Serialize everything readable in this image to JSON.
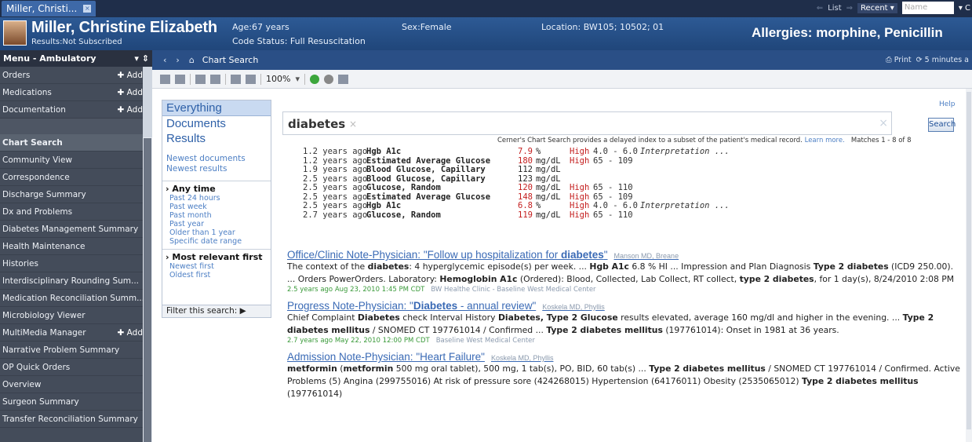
{
  "titlebar": {
    "tab_label": "Miller, Christi...",
    "tab_close": "×",
    "list_label": "List",
    "recent_label": "Recent",
    "recent_caret": "▾",
    "name_placeholder": "Name",
    "trailing": "▾ C"
  },
  "banner": {
    "name": "Miller, Christine Elizabeth",
    "results": "Results:Not Subscribed",
    "age": "Age:67 years",
    "code_status": "Code Status: Full Resuscitation",
    "sex": "Sex:Female",
    "location": "Location: BW105; 10502; 01",
    "allergies": "Allergies: morphine, Penicillin"
  },
  "menu": {
    "header": "Menu - Ambulatory",
    "header_icons": "▾ ⇕",
    "add_label": "Add",
    "items_top": [
      {
        "label": "Orders",
        "add": true
      },
      {
        "label": "Medications",
        "add": true
      },
      {
        "label": "Documentation",
        "add": true
      }
    ],
    "items": [
      {
        "label": "Chart Search",
        "active": true
      },
      {
        "label": "Community View"
      },
      {
        "label": "Correspondence"
      },
      {
        "label": "Discharge Summary"
      },
      {
        "label": "Dx and Problems"
      },
      {
        "label": "Diabetes Management Summary"
      },
      {
        "label": "Health Maintenance"
      },
      {
        "label": "Histories"
      },
      {
        "label": "Interdisciplinary Rounding Sum..."
      },
      {
        "label": "Medication Reconciliation Summ..."
      },
      {
        "label": "Microbiology Viewer"
      },
      {
        "label": "MultiMedia Manager",
        "add": true
      },
      {
        "label": "Narrative Problem Summary"
      },
      {
        "label": "OP Quick Orders"
      },
      {
        "label": "Overview"
      },
      {
        "label": "Surgeon Summary"
      },
      {
        "label": "Transfer Reconciliation Summary"
      }
    ]
  },
  "navbar": {
    "back": "‹",
    "forward": "›",
    "home": "⌂",
    "title": "Chart Search",
    "print": "Print",
    "refresh": "5 minutes a"
  },
  "toolbar": {
    "zoom": "100%"
  },
  "filters": {
    "categories": [
      "Everything",
      "Documents",
      "Results"
    ],
    "sort_links": [
      "Newest documents",
      "Newest results"
    ],
    "time_header": "Any time",
    "time_options": [
      "Past 24 hours",
      "Past week",
      "Past month",
      "Past year",
      "Older than 1 year",
      "Specific date range"
    ],
    "relevance_header": "Most relevant first",
    "relevance_options": [
      "Newest first",
      "Oldest first"
    ],
    "filter_label": "Filter this search:"
  },
  "search": {
    "term": "diabetes",
    "help": "Help",
    "button": "Search",
    "disclaimer": "Cerner's Chart Search provides a delayed index to a subset of the patient's medical record.",
    "learn_more": "Learn more.",
    "matches": "Matches 1 - 8 of 8"
  },
  "labs": [
    {
      "ago": "1.2 years ago",
      "name": "Hgb A1c",
      "value": "7.9",
      "unit": "%",
      "flag": "High",
      "range": "4.0 - 6.0",
      "interp": "Interpretation ...",
      "abnormal": true
    },
    {
      "ago": "1.2 years ago",
      "name": "Estimated Average Glucose",
      "value": "180",
      "unit": "mg/dL",
      "flag": "High",
      "range": "65 - 109",
      "interp": "",
      "abnormal": true
    },
    {
      "ago": "1.9 years ago",
      "name": "Blood Glucose, Capillary",
      "value": "112",
      "unit": "mg/dL",
      "flag": "",
      "range": "",
      "interp": "",
      "abnormal": false
    },
    {
      "ago": "2.5 years ago",
      "name": "Blood Glucose, Capillary",
      "value": "123",
      "unit": "mg/dL",
      "flag": "",
      "range": "",
      "interp": "",
      "abnormal": false
    },
    {
      "ago": "2.5 years ago",
      "name": "Glucose, Random",
      "value": "120",
      "unit": "mg/dL",
      "flag": "High",
      "range": "65 - 110",
      "interp": "",
      "abnormal": true
    },
    {
      "ago": "2.5 years ago",
      "name": "Estimated Average Glucose",
      "value": "148",
      "unit": "mg/dL",
      "flag": "High",
      "range": "65 - 109",
      "interp": "",
      "abnormal": true
    },
    {
      "ago": "2.5 years ago",
      "name": "Hgb A1c",
      "value": "6.8",
      "unit": "%",
      "flag": "High",
      "range": "4.0 - 6.0",
      "interp": "Interpretation ...",
      "abnormal": true
    },
    {
      "ago": "2.7 years ago",
      "name": "Glucose, Random",
      "value": "119",
      "unit": "mg/dL",
      "flag": "High",
      "range": "65 - 110",
      "interp": "",
      "abnormal": true
    }
  ],
  "notes": [
    {
      "title_pre": "Office/Clinic Note-Physician: \"Follow up hospitalization for ",
      "title_hl": "diabetes",
      "title_post": "\"",
      "author": "Manson MD, Breane",
      "body_html": "The context of the <b>diabetes</b>: 4 hyperglycemic episode(s) per week. ... <b>Hgb A1c</b> 6.8 % HI ... Impression and Plan Diagnosis <b>Type 2 diabetes</b> (ICD9 250.00). ... Orders PowerOrders. Laboratory: <b>Hemoglobin A1c</b> (Ordered): Blood, Collected, Lab Collect, RT collect, <b>type 2 diabetes</b>, for 1 day(s), 8/24/2010 2:08 PM",
      "age": "2.5 years ago",
      "date": "Aug 23, 2010 1:45 PM CDT",
      "facility": "BW Healthe Clinic - Baseline West Medical Center"
    },
    {
      "title_pre": "Progress Note-Physician: \"",
      "title_hl": "Diabetes",
      "title_post": " - annual review\"",
      "author": "Koskela MD, Phyllis",
      "body_html": "Chief Complaint <b>Diabetes</b> check Interval History <b>Diabetes, Type 2 Glucose</b> results elevated, average 160 mg/dl and higher in the evening. ... <b>Type 2 diabetes mellitus</b> / SNOMED CT 197761014 / Confirmed ... <b>Type 2 diabetes mellitus</b> (197761014): Onset in 1981 at 36 years.",
      "age": "2.7 years ago",
      "date": "May 22, 2010 12:00 PM CDT",
      "facility": "Baseline West Medical Center"
    },
    {
      "title_pre": "Admission Note-Physician: \"Heart Failure\"",
      "title_hl": "",
      "title_post": "",
      "author": "Koskela MD, Phyllis",
      "body_html": "<b>metformin</b> (<b>metformin</b> 500 mg oral tablet), 500 mg, 1 tab(s), PO, BID, 60 tab(s) ... <b>Type 2 diabetes mellitus</b> / SNOMED CT 197761014 / Confirmed. Active Problems (5) Angina (299755016) At risk of pressure sore (424268015) Hypertension (64176011) Obesity (2535065012) <b>Type 2 diabetes mellitus</b> (197761014)",
      "age": "",
      "date": "",
      "facility": ""
    }
  ]
}
